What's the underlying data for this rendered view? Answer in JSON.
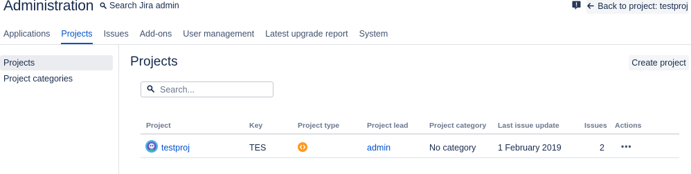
{
  "header": {
    "title": "Administration",
    "search_label": "Search Jira admin",
    "back_button_label": "Back to project: testproj"
  },
  "nav": {
    "tabs": [
      {
        "label": "Applications",
        "active": false
      },
      {
        "label": "Projects",
        "active": true
      },
      {
        "label": "Issues",
        "active": false
      },
      {
        "label": "Add-ons",
        "active": false
      },
      {
        "label": "User management",
        "active": false
      },
      {
        "label": "Latest upgrade report",
        "active": false
      },
      {
        "label": "System",
        "active": false
      }
    ]
  },
  "sidebar": {
    "items": [
      {
        "label": "Projects",
        "active": true
      },
      {
        "label": "Project categories",
        "active": false
      }
    ]
  },
  "main": {
    "title": "Projects",
    "create_button_label": "Create project",
    "search_placeholder": "Search...",
    "table": {
      "columns": [
        "Project",
        "Key",
        "Project type",
        "Project lead",
        "Project category",
        "Last issue update",
        "Issues",
        "Actions"
      ],
      "rows": [
        {
          "project": "testproj",
          "key": "TES",
          "project_type_icon": "software-project-icon",
          "lead": "admin",
          "category": "No category",
          "last_update": "1 February 2019",
          "issues": "2",
          "actions_icon": "more-icon"
        }
      ]
    }
  },
  "colors": {
    "accent": "#0052CC",
    "text": "#172B4D",
    "muted": "#6B778C",
    "button_bg": "#F4F5F7",
    "sidebar_active_bg": "#EBECF0",
    "border": "#DFE1E6",
    "project_type_orange": "#FF991F"
  }
}
